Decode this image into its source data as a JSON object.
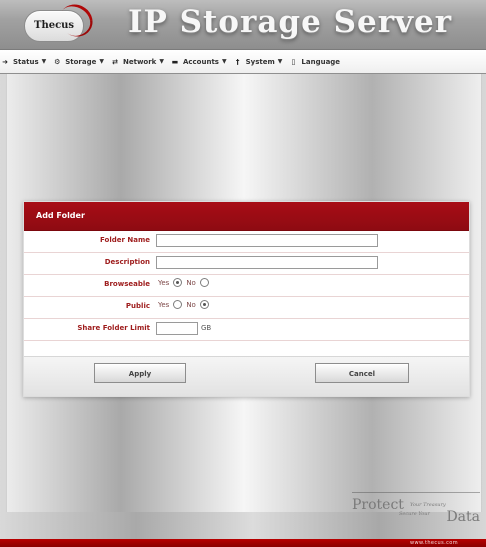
{
  "header": {
    "logo_text": "Thecus",
    "title": "IP Storage Server"
  },
  "menu": [
    {
      "label": "Status",
      "icon": "arrow-right-icon"
    },
    {
      "label": "Storage",
      "icon": "gear-icon"
    },
    {
      "label": "Network",
      "icon": "network-icon"
    },
    {
      "label": "Accounts",
      "icon": "folder-icon"
    },
    {
      "label": "System",
      "icon": "wrench-icon"
    },
    {
      "label": "Language",
      "icon": "document-icon"
    }
  ],
  "dialog": {
    "title": "Add Folder",
    "fields": {
      "folder_name": {
        "label": "Folder Name",
        "value": ""
      },
      "description": {
        "label": "Description",
        "value": ""
      },
      "browseable": {
        "label": "Browseable",
        "yes": "Yes",
        "no": "No",
        "selected": "yes"
      },
      "public": {
        "label": "Public",
        "yes": "Yes",
        "no": "No",
        "selected": "no"
      },
      "share_folder_limit": {
        "label": "Share Folder Limit",
        "value": "",
        "unit": "GB"
      }
    },
    "buttons": {
      "apply": "Apply",
      "cancel": "Cancel"
    }
  },
  "branding": {
    "protect": "Protect",
    "small_1": "Your Treasury",
    "small_2": "Secure Your",
    "data": "Data",
    "url": "www.thecus.com"
  },
  "colors": {
    "header_red": "#a80d16",
    "label_red": "#9e1c1c",
    "footer_red": "#9b0000"
  }
}
